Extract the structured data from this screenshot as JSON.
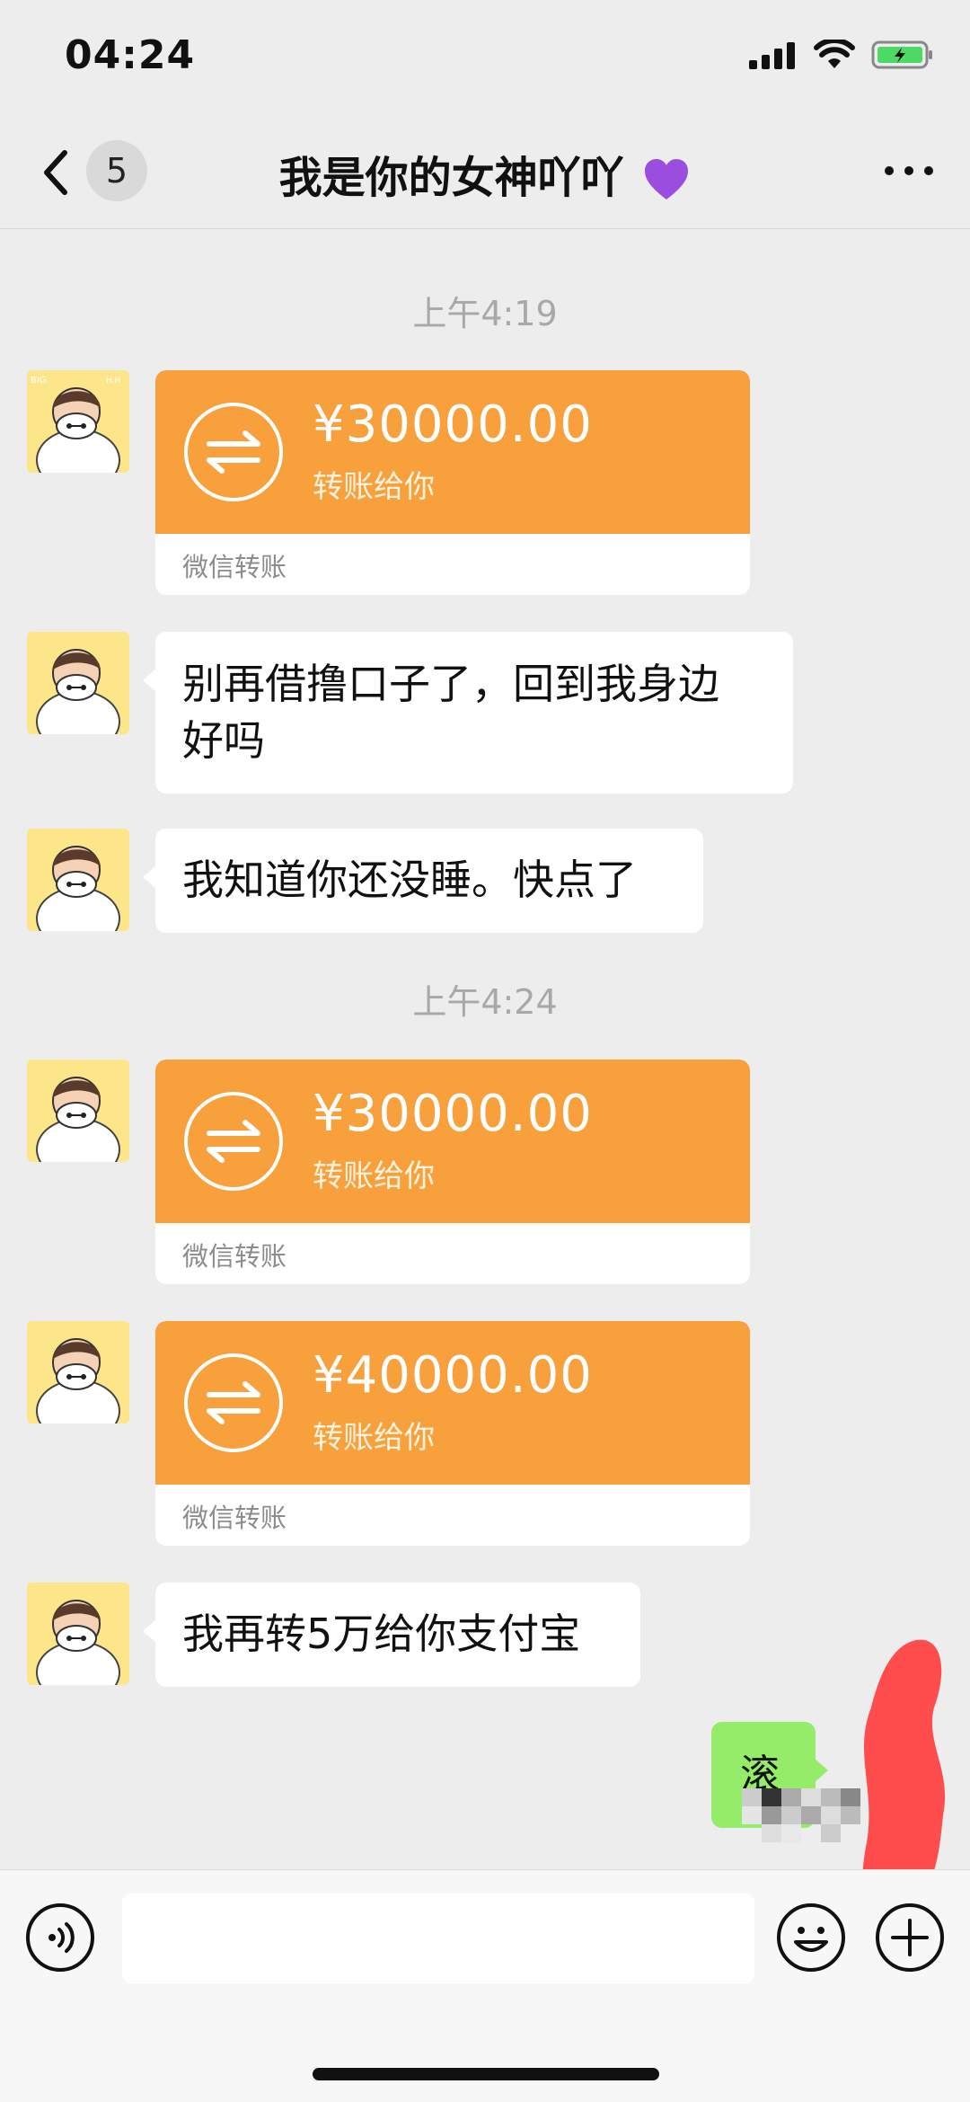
{
  "status_bar": {
    "time": "04:24"
  },
  "nav": {
    "title": "我是你的女神吖吖",
    "unread_count": "5"
  },
  "messages": [
    {
      "type": "timestamp",
      "text": "上午4:19"
    },
    {
      "type": "transfer",
      "amount": "¥30000.00",
      "desc": "转账给你",
      "label": "微信转账"
    },
    {
      "type": "text",
      "lines": [
        "别再借撸口子了，回到我身边",
        "好吗"
      ]
    },
    {
      "type": "text",
      "lines": [
        "我知道你还没睡。快点了"
      ]
    },
    {
      "type": "timestamp",
      "text": "上午4:24"
    },
    {
      "type": "transfer",
      "amount": "¥30000.00",
      "desc": "转账给你",
      "label": "微信转账"
    },
    {
      "type": "transfer",
      "amount": "¥40000.00",
      "desc": "转账给你",
      "label": "微信转账"
    },
    {
      "type": "text",
      "lines": [
        "我再转5万给你支付宝"
      ]
    },
    {
      "type": "outgoing",
      "text": "滚"
    }
  ],
  "input_bar": {
    "placeholder": ""
  },
  "colors": {
    "transfer_orange": "#F7A03C",
    "my_bubble": "#95EC69",
    "background": "#EDEDED"
  }
}
